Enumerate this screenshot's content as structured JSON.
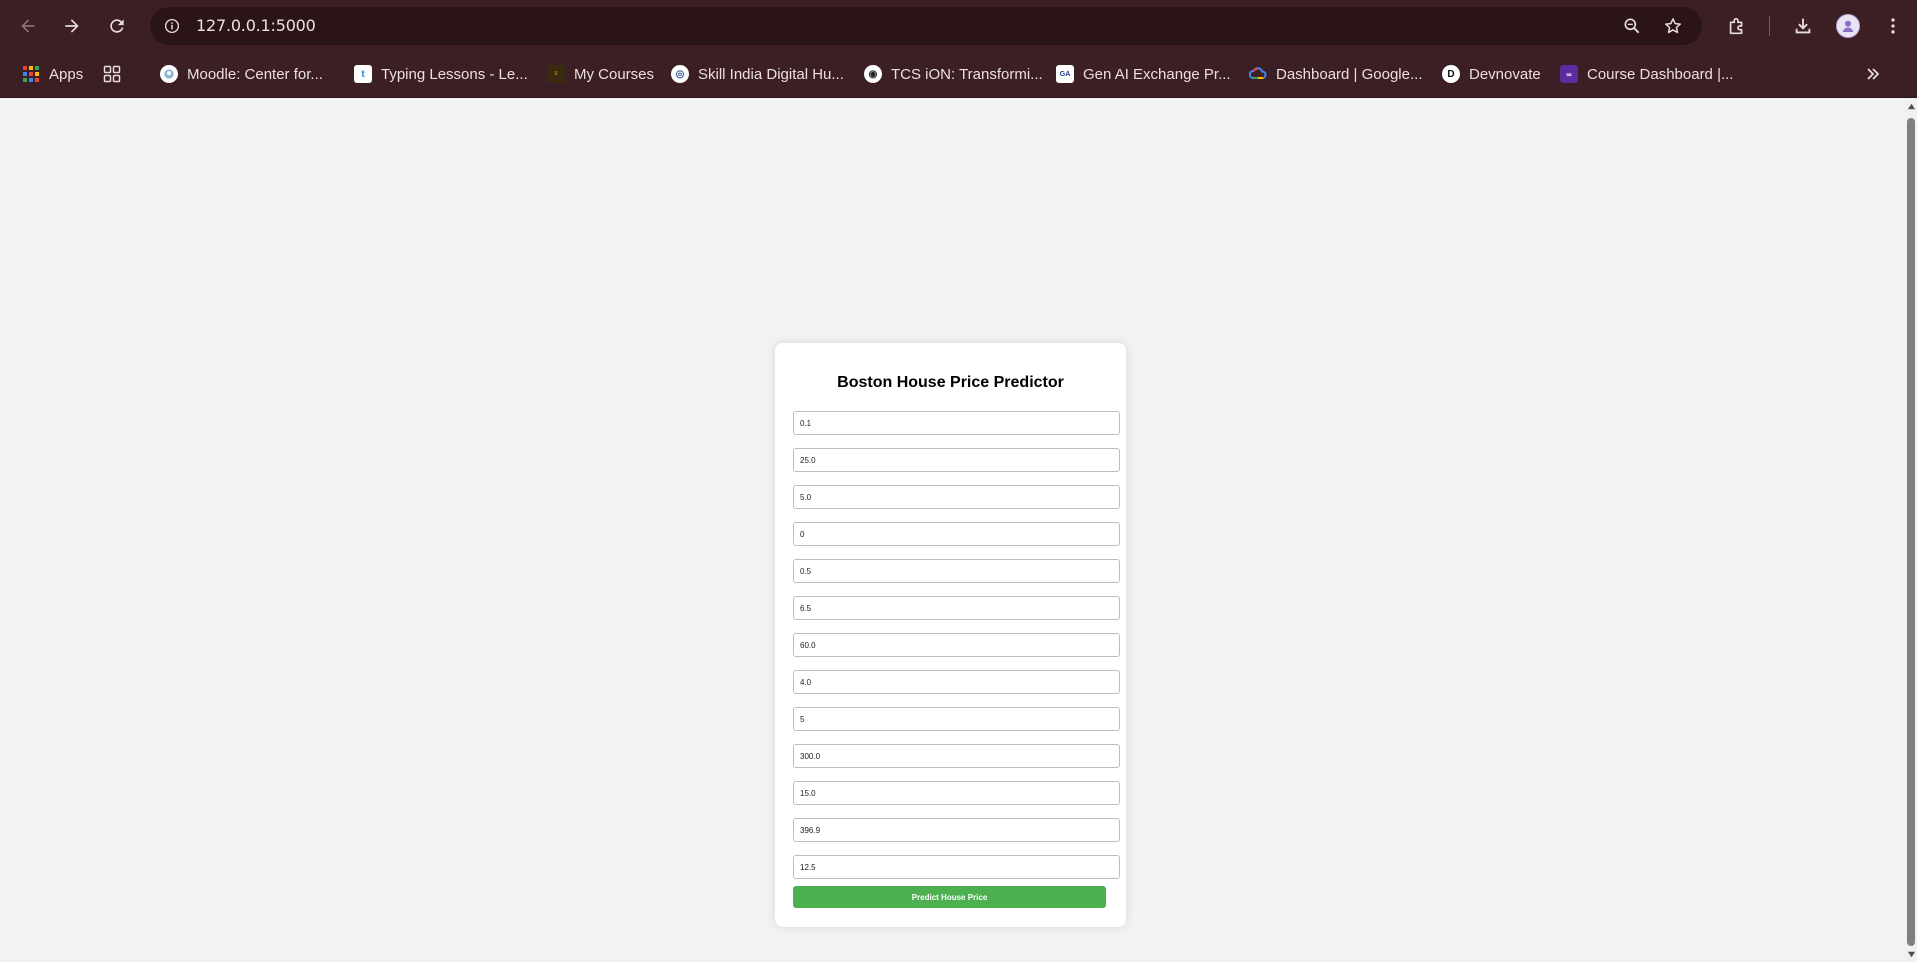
{
  "browser": {
    "url": "127.0.0.1:5000",
    "icons": {
      "back": "arrow-left-icon",
      "forward": "arrow-right-icon",
      "reload": "reload-icon",
      "site_info": "info-icon",
      "zoom": "zoom-icon",
      "bookmark_star": "star-icon",
      "extensions": "puzzle-icon",
      "downloads": "download-icon",
      "menu": "kebab-menu-icon",
      "more_bookmarks": "chevron-double-right-icon"
    }
  },
  "bookmarks": [
    {
      "label": "Apps",
      "icon": "apps-grid-icon"
    },
    {
      "label": "",
      "icon": "tab-groups-icon"
    },
    {
      "label": "Moodle: Center for...",
      "icon": "moodle-icon"
    },
    {
      "label": "Typing Lessons - Le...",
      "icon": "typing-icon"
    },
    {
      "label": "My Courses",
      "icon": "courses-icon"
    },
    {
      "label": "Skill India Digital Hu...",
      "icon": "skill-india-icon"
    },
    {
      "label": "TCS iON: Transformi...",
      "icon": "tcs-ion-icon"
    },
    {
      "label": "Gen AI Exchange Pr...",
      "icon": "gen-ai-icon"
    },
    {
      "label": "Dashboard | Google...",
      "icon": "google-cloud-icon"
    },
    {
      "label": "Devnovate",
      "icon": "devnovate-icon"
    },
    {
      "label": "Course Dashboard |...",
      "icon": "course-dashboard-icon"
    }
  ],
  "form": {
    "title": "Boston House Price Predictor",
    "fields": [
      "0.1",
      "25.0",
      "5.0",
      "0",
      "0.5",
      "6.5",
      "60.0",
      "4.0",
      "5",
      "300.0",
      "15.0",
      "396.9",
      "12.5"
    ],
    "submit_label": "Predict House Price",
    "accent_color": "#4caf50"
  }
}
